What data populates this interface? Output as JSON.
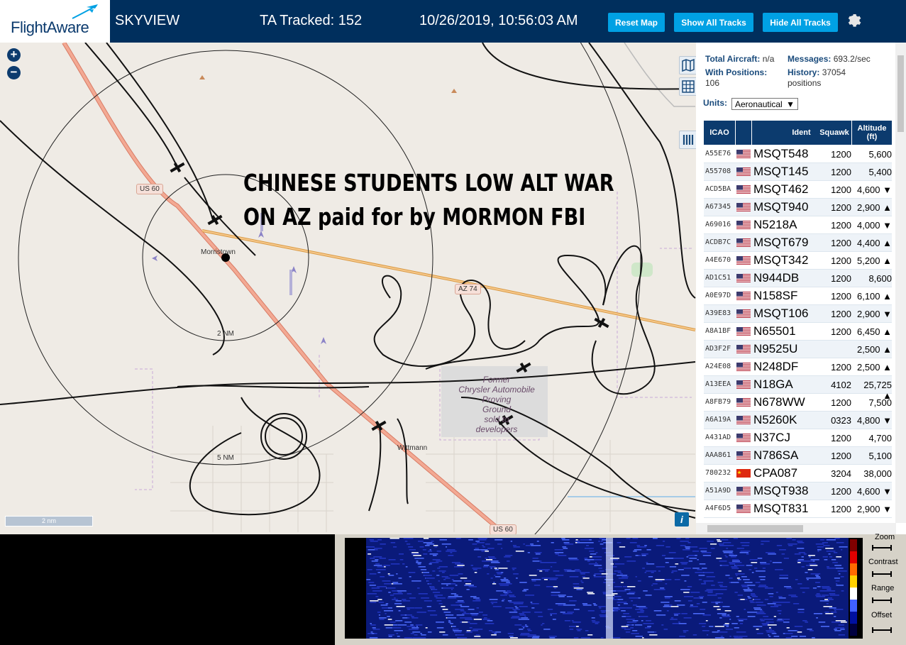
{
  "header": {
    "logo": "FlightAware",
    "app_name": "SKYVIEW",
    "ta_tracked": "TA Tracked: 152",
    "datetime": "10/26/2019, 10:56:03 AM",
    "buttons": [
      "Reset Map",
      "Show All Tracks",
      "Hide All Tracks"
    ]
  },
  "map": {
    "headline_line1": "CHINESE STUDENTS LOW ALT WAR",
    "headline_line2": "ON AZ paid for by MORMON FBI",
    "labels": {
      "us60_top": "US 60",
      "us60_bottom": "US 60",
      "az74": "AZ 74",
      "morristown": "Morristown",
      "wittmann": "Wittmann",
      "ring2": "2 NM",
      "ring5": "5 NM",
      "proving_ground": [
        "Former",
        "Chrysler Automobile",
        "Proving",
        "Ground",
        "sold to",
        "developers"
      ]
    },
    "scale": "2 nm"
  },
  "panel": {
    "total_aircraft_label": "Total Aircraft:",
    "total_aircraft_value": "n/a",
    "messages_label": "Messages:",
    "messages_value": "693.2/sec",
    "with_positions_label": "With Positions:",
    "with_positions_value": "106",
    "history_label": "History:",
    "history_value": "37054 positions",
    "units_label": "Units:",
    "units_value": "Aeronautical",
    "columns": [
      "ICAO",
      "",
      "Ident",
      "Squawk",
      "Altitude (ft)"
    ],
    "rows": [
      {
        "icao": "A55E76",
        "flag": "us",
        "ident": "MSQT548",
        "squawk": "1200",
        "alt": "5,600"
      },
      {
        "icao": "A55708",
        "flag": "us",
        "ident": "MSQT145",
        "squawk": "1200",
        "alt": "5,400"
      },
      {
        "icao": "ACD5BA",
        "flag": "us",
        "ident": "MSQT462",
        "squawk": "1200",
        "alt": "4,600 ▼"
      },
      {
        "icao": "A67345",
        "flag": "us",
        "ident": "MSQT940",
        "squawk": "1200",
        "alt": "2,900 ▲"
      },
      {
        "icao": "A69016",
        "flag": "us",
        "ident": "N5218A",
        "squawk": "1200",
        "alt": "4,000 ▼"
      },
      {
        "icao": "ACDB7C",
        "flag": "us",
        "ident": "MSQT679",
        "squawk": "1200",
        "alt": "4,400 ▲"
      },
      {
        "icao": "A4E670",
        "flag": "us",
        "ident": "MSQT342",
        "squawk": "1200",
        "alt": "5,200 ▲"
      },
      {
        "icao": "AD1C51",
        "flag": "us",
        "ident": "N944DB",
        "squawk": "1200",
        "alt": "8,600"
      },
      {
        "icao": "A0E97D",
        "flag": "us",
        "ident": "N158SF",
        "squawk": "1200",
        "alt": "6,100 ▲"
      },
      {
        "icao": "A39E83",
        "flag": "us",
        "ident": "MSQT106",
        "squawk": "1200",
        "alt": "2,900 ▼"
      },
      {
        "icao": "A8A1BF",
        "flag": "us",
        "ident": "N65501",
        "squawk": "1200",
        "alt": "6,450 ▲"
      },
      {
        "icao": "AD3F2F",
        "flag": "us",
        "ident": "N9525U",
        "squawk": "",
        "alt": "2,500 ▲"
      },
      {
        "icao": "A24E08",
        "flag": "us",
        "ident": "N248DF",
        "squawk": "1200",
        "alt": "2,500 ▲"
      },
      {
        "icao": "A13EEA",
        "flag": "us",
        "ident": "N18GA",
        "squawk": "4102",
        "alt": "25,725 ▲"
      },
      {
        "icao": "A8FB79",
        "flag": "us",
        "ident": "N678WW",
        "squawk": "1200",
        "alt": "7,500"
      },
      {
        "icao": "A6A19A",
        "flag": "us",
        "ident": "N5260K",
        "squawk": "0323",
        "alt": "4,800 ▼"
      },
      {
        "icao": "A431AD",
        "flag": "us",
        "ident": "N37CJ",
        "squawk": "1200",
        "alt": "4,700"
      },
      {
        "icao": "AAA861",
        "flag": "us",
        "ident": "N786SA",
        "squawk": "1200",
        "alt": "5,100"
      },
      {
        "icao": "780232",
        "flag": "cn",
        "ident": "CPA087",
        "squawk": "3204",
        "alt": "38,000"
      },
      {
        "icao": "A51A9D",
        "flag": "us",
        "ident": "MSQT938",
        "squawk": "1200",
        "alt": "4,600 ▼"
      },
      {
        "icao": "A4F6D5",
        "flag": "us",
        "ident": "MSQT831",
        "squawk": "1200",
        "alt": "2,900 ▼"
      }
    ]
  },
  "waterfall": {
    "controls": [
      "Zoom",
      "Contrast",
      "Range",
      "Offset"
    ]
  },
  "colors": {
    "header_bg": "#002f5d",
    "button_bg": "#00a1e4",
    "table_header_bg": "#0c3b6e",
    "map_bg": "#efebe5",
    "us60_road": "#e9937c",
    "az74_road": "#f0b360"
  }
}
